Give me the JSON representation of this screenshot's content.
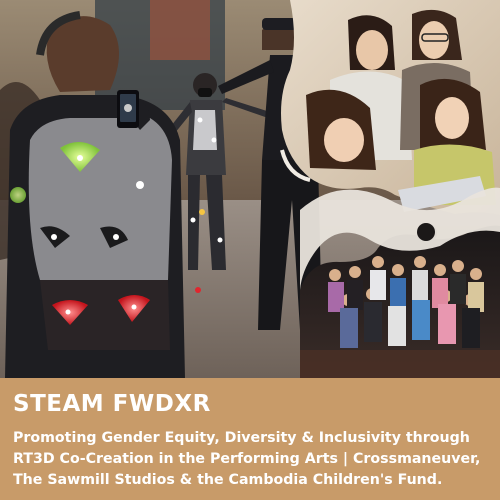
{
  "banner": {
    "title": "STEAM FWDXR",
    "subtitle_lines": [
      "Promoting Gender Equity, Diversity & Inclusivity through",
      "RT3D Co-Creation in the Performing Arts | Crossmaneuver,",
      "The Sawmill Studios & the Cambodia Children's Fund."
    ]
  },
  "colors": {
    "banner_bg": "#c89b69",
    "banner_text": "#ffffff",
    "marker_green": "#9be04a",
    "marker_red": "#e0262e"
  },
  "images": {
    "main_photo": "mocap-studio-photo",
    "top_right_photo": "students-at-laptop-photo",
    "bottom_right_photo": "dance-troupe-group-photo"
  }
}
